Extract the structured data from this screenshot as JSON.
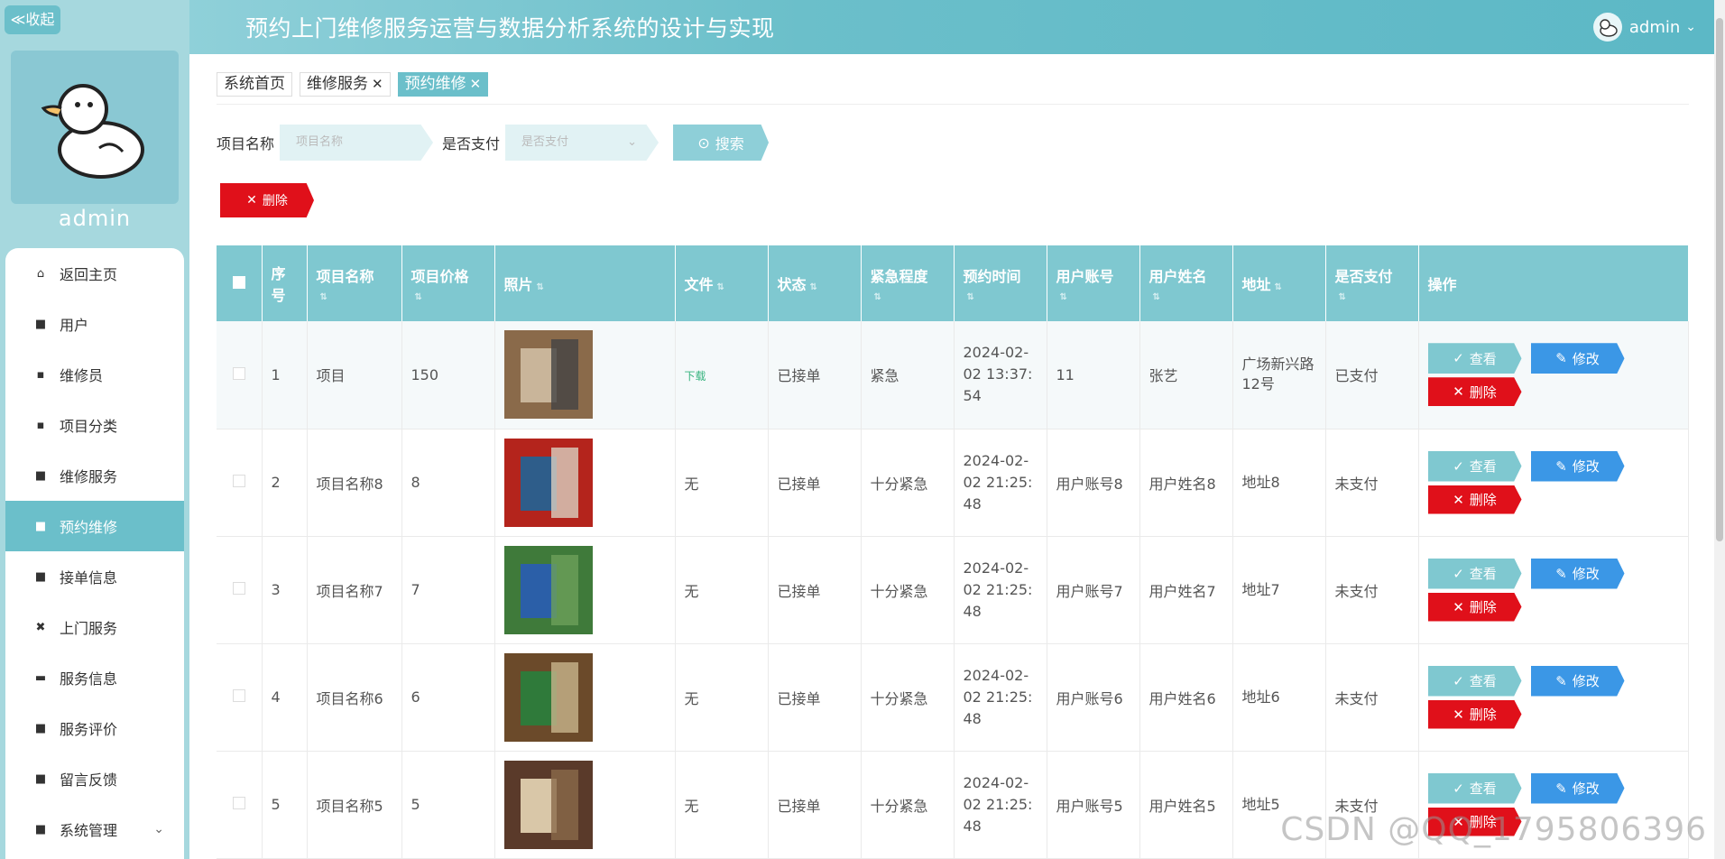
{
  "sidebar": {
    "collapse_label": "≪收起",
    "username": "admin",
    "items": [
      {
        "label": "返回主页",
        "icon": "home-icon"
      },
      {
        "label": "用户",
        "icon": "grid-icon"
      },
      {
        "label": "维修员",
        "icon": "square-icon"
      },
      {
        "label": "项目分类",
        "icon": "square-icon"
      },
      {
        "label": "维修服务",
        "icon": "grid-icon"
      },
      {
        "label": "预约维修",
        "icon": "grid-icon"
      },
      {
        "label": "接单信息",
        "icon": "grid-icon"
      },
      {
        "label": "上门服务",
        "icon": "ticket-icon"
      },
      {
        "label": "服务信息",
        "icon": "briefcase-icon"
      },
      {
        "label": "服务评价",
        "icon": "grid-icon"
      },
      {
        "label": "留言反馈",
        "icon": "grid-icon"
      },
      {
        "label": "系统管理",
        "icon": "grid-icon"
      }
    ],
    "active_index": 5
  },
  "header": {
    "title": "预约上门维修服务运营与数据分析系统的设计与实现",
    "user": "admin"
  },
  "tabs": [
    {
      "label": "系统首页",
      "closable": false
    },
    {
      "label": "维修服务",
      "closable": true
    },
    {
      "label": "预约维修",
      "closable": true
    }
  ],
  "search": {
    "name_label": "项目名称",
    "name_placeholder": "项目名称",
    "paid_label": "是否支付",
    "paid_placeholder": "是否支付",
    "button": "搜索"
  },
  "toolbar": {
    "delete_label": "删除"
  },
  "table": {
    "headers": [
      "序号",
      "项目名称",
      "项目价格",
      "照片",
      "文件",
      "状态",
      "紧急程度",
      "预约时间",
      "用户账号",
      "用户姓名",
      "地址",
      "是否支付",
      "操作"
    ],
    "rows": [
      {
        "idx": "1",
        "name": "项目",
        "price": "150",
        "file": "下载",
        "status": "已接单",
        "urgency": "紧急",
        "time": "2024-02-02 13:37:54",
        "account": "11",
        "uname": "张艺",
        "addr": "广场新兴路12号",
        "paid": "已支付"
      },
      {
        "idx": "2",
        "name": "项目名称8",
        "price": "8",
        "file": "无",
        "status": "已接单",
        "urgency": "十分紧急",
        "time": "2024-02-02 21:25:48",
        "account": "用户账号8",
        "uname": "用户姓名8",
        "addr": "地址8",
        "paid": "未支付"
      },
      {
        "idx": "3",
        "name": "项目名称7",
        "price": "7",
        "file": "无",
        "status": "已接单",
        "urgency": "十分紧急",
        "time": "2024-02-02 21:25:48",
        "account": "用户账号7",
        "uname": "用户姓名7",
        "addr": "地址7",
        "paid": "未支付"
      },
      {
        "idx": "4",
        "name": "项目名称6",
        "price": "6",
        "file": "无",
        "status": "已接单",
        "urgency": "十分紧急",
        "time": "2024-02-02 21:25:48",
        "account": "用户账号6",
        "uname": "用户姓名6",
        "addr": "地址6",
        "paid": "未支付"
      },
      {
        "idx": "5",
        "name": "项目名称5",
        "price": "5",
        "file": "无",
        "status": "已接单",
        "urgency": "十分紧急",
        "time": "2024-02-02 21:25:48",
        "account": "用户账号5",
        "uname": "用户姓名5",
        "addr": "地址5",
        "paid": "未支付"
      }
    ],
    "actions": {
      "view": "查看",
      "edit": "修改",
      "delete": "删除"
    }
  },
  "watermark": "CSDN @QQ_1795806396",
  "colors": {
    "accent": "#6bbfca",
    "danger": "#e0101a",
    "primary": "#3b97e6"
  }
}
